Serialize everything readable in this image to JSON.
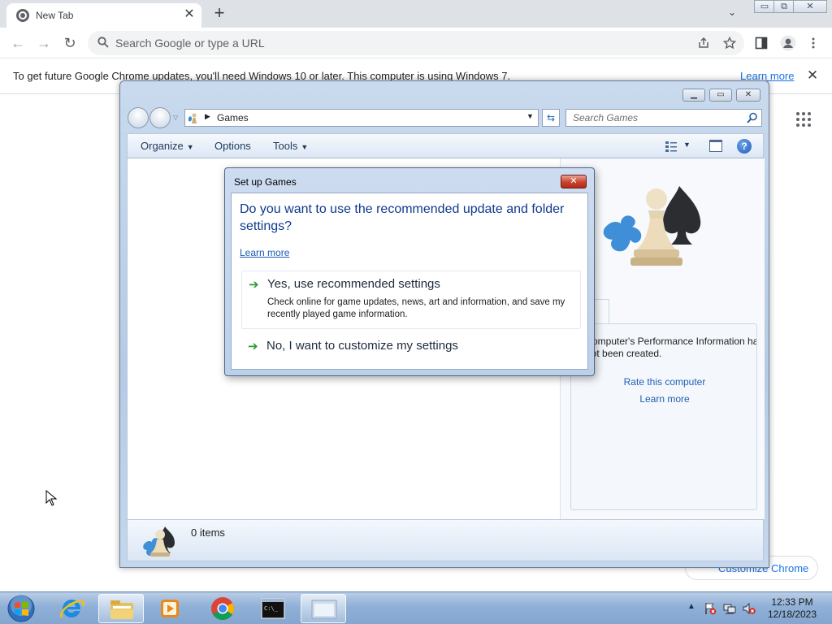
{
  "browser": {
    "tab_title": "New Tab",
    "tab_close": "✕",
    "new_tab": "+",
    "tab_search": "⌄",
    "window_controls": {
      "minimize": "▭",
      "maximize": "⧉",
      "close": "✕"
    },
    "back": "←",
    "forward": "→",
    "reload": "↻",
    "omnibox_placeholder": "Search Google or type a URL",
    "toolbar_icons": [
      "share-icon",
      "bookmark-star-icon",
      "side-panel-icon",
      "profile-icon",
      "menu-icon"
    ],
    "infobar": {
      "message": "To get future Google Chrome updates, you'll need Windows 10 or later. This computer is using Windows 7.",
      "learn_more": "Learn more",
      "close": "✕"
    },
    "customize_label": "Customize Chrome"
  },
  "games_window": {
    "address": "Games",
    "search_placeholder": "Search Games",
    "commands": {
      "organize": "Organize",
      "options": "Options",
      "tools": "Tools"
    },
    "help": "?",
    "performance_text": "This computer's Performance Information has not been created.",
    "rate_link": "Rate this computer",
    "learn_link": "Learn more",
    "item_count": "0 items"
  },
  "dialog": {
    "title": "Set up Games",
    "close": "✕",
    "question": "Do you want to use the recommended update and folder settings?",
    "learn_more": "Learn more",
    "option_recommended": {
      "title": "Yes, use recommended settings",
      "description": "Check online for game updates, news, art and information, and save my recently played game information."
    },
    "option_custom": {
      "title": "No, I want to customize my settings"
    },
    "arrow": "➔"
  },
  "taskbar": {
    "tray_arrow": "▲",
    "time": "12:33 PM",
    "date": "12/18/2023"
  }
}
